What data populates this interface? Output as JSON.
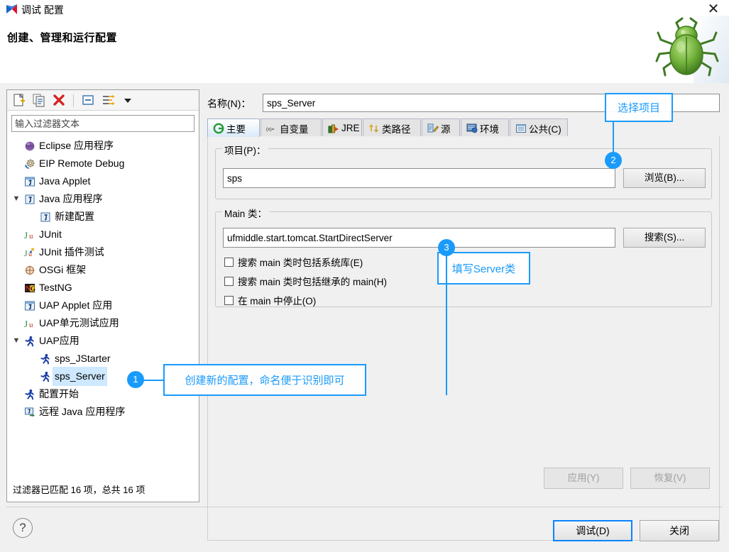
{
  "window": {
    "title": "调试 配置",
    "title_icon": "debug-config-icon",
    "close_icon": "close-icon",
    "heading": "创建、管理和运行配置",
    "decoration_icon": "green-bug-icon"
  },
  "left_panel": {
    "toolbar": [
      {
        "name": "new-configuration-button",
        "icon": "new-document-icon"
      },
      {
        "name": "duplicate-configuration-button",
        "icon": "copy-icon"
      },
      {
        "name": "delete-configuration-button",
        "icon": "red-x-icon"
      },
      {
        "name": "collapse-all-button",
        "icon": "collapse-all-icon"
      },
      {
        "name": "filter-configurations-button",
        "icon": "filter-icon"
      },
      {
        "name": "view-menu-button",
        "icon": "chevron-down-icon"
      }
    ],
    "filter": {
      "placeholder": "输入过滤器文本",
      "value": ""
    },
    "tree": [
      {
        "label": "Eclipse 应用程序",
        "icon": "purple-sphere-icon",
        "indent": 1,
        "twisty": "",
        "selected": false
      },
      {
        "label": "EIP Remote Debug",
        "icon": "gear-debug-icon",
        "indent": 1,
        "twisty": "",
        "selected": false
      },
      {
        "label": "Java Applet",
        "icon": "java-applet-icon",
        "indent": 1,
        "twisty": "",
        "selected": false
      },
      {
        "label": "Java 应用程序",
        "icon": "java-app-icon",
        "indent": 1,
        "twisty": "▼",
        "selected": false
      },
      {
        "label": "新建配置",
        "icon": "java-app-icon",
        "indent": 2,
        "twisty": "",
        "selected": false
      },
      {
        "label": "JUnit",
        "icon": "junit-icon",
        "indent": 1,
        "twisty": "",
        "selected": false
      },
      {
        "label": "JUnit 插件测试",
        "icon": "junit-plugin-icon",
        "indent": 1,
        "twisty": "",
        "selected": false
      },
      {
        "label": "OSGi 框架",
        "icon": "osgi-icon",
        "indent": 1,
        "twisty": "",
        "selected": false
      },
      {
        "label": "TestNG",
        "icon": "testng-icon",
        "indent": 1,
        "twisty": "",
        "selected": false
      },
      {
        "label": "UAP Applet 应用",
        "icon": "java-applet-icon",
        "indent": 1,
        "twisty": "",
        "selected": false
      },
      {
        "label": "UAP单元测试应用",
        "icon": "junit-icon",
        "indent": 1,
        "twisty": "",
        "selected": false
      },
      {
        "label": "UAP应用",
        "icon": "runner-icon",
        "indent": 1,
        "twisty": "▼",
        "selected": false
      },
      {
        "label": "sps_JStarter",
        "icon": "runner-icon",
        "indent": 2,
        "twisty": "",
        "selected": false
      },
      {
        "label": "sps_Server",
        "icon": "runner-icon",
        "indent": 2,
        "twisty": "",
        "selected": true
      },
      {
        "label": "配置开始",
        "icon": "runner-icon",
        "indent": 1,
        "twisty": "",
        "selected": false
      },
      {
        "label": "远程 Java 应用程序",
        "icon": "remote-java-icon",
        "indent": 1,
        "twisty": "",
        "selected": false
      }
    ],
    "status": "过滤器已匹配 16 项，总共 16 项"
  },
  "right_panel": {
    "name_label": "名称(N)：",
    "name_value": "sps_Server",
    "tabs": [
      {
        "label": "主要",
        "icon": "main-tab-icon",
        "active": true
      },
      {
        "label": "自变量",
        "icon": "arguments-icon",
        "active": false
      },
      {
        "label": "JRE",
        "icon": "jre-icon",
        "active": false
      },
      {
        "label": "类路径",
        "icon": "classpath-icon",
        "active": false
      },
      {
        "label": "源",
        "icon": "source-icon",
        "active": false
      },
      {
        "label": "环境",
        "icon": "environment-icon",
        "active": false
      },
      {
        "label": "公共(C)",
        "icon": "common-icon",
        "active": false
      }
    ],
    "project_group": {
      "title": "项目(P)：",
      "value": "sps",
      "browse_button": "浏览(B)..."
    },
    "main_class_group": {
      "title": "Main 类：",
      "value": "ufmiddle.start.tomcat.StartDirectServer",
      "search_button": "搜索(S)...",
      "checkboxes": [
        {
          "label": "搜索 main 类时包括系统库(E)",
          "checked": false
        },
        {
          "label": "搜索 main 类时包括继承的 main(H)",
          "checked": false
        },
        {
          "label": "在 main 中停止(O)",
          "checked": false
        }
      ]
    },
    "apply_button": "应用(Y)",
    "revert_button": "恢复(V)"
  },
  "footer": {
    "help_icon": "question-mark-icon",
    "debug_button": "调试(D)",
    "close_button": "关闭"
  },
  "annotations": [
    {
      "badge": "1",
      "text": "创建新的配置，命名便于识别即可"
    },
    {
      "badge": "2",
      "text": "选择项目"
    },
    {
      "badge": "3",
      "text": "填写Server类"
    }
  ],
  "colors": {
    "accent": "#1a9bfc",
    "selection": "#cde8ff",
    "panel": "#f0f0f0"
  }
}
